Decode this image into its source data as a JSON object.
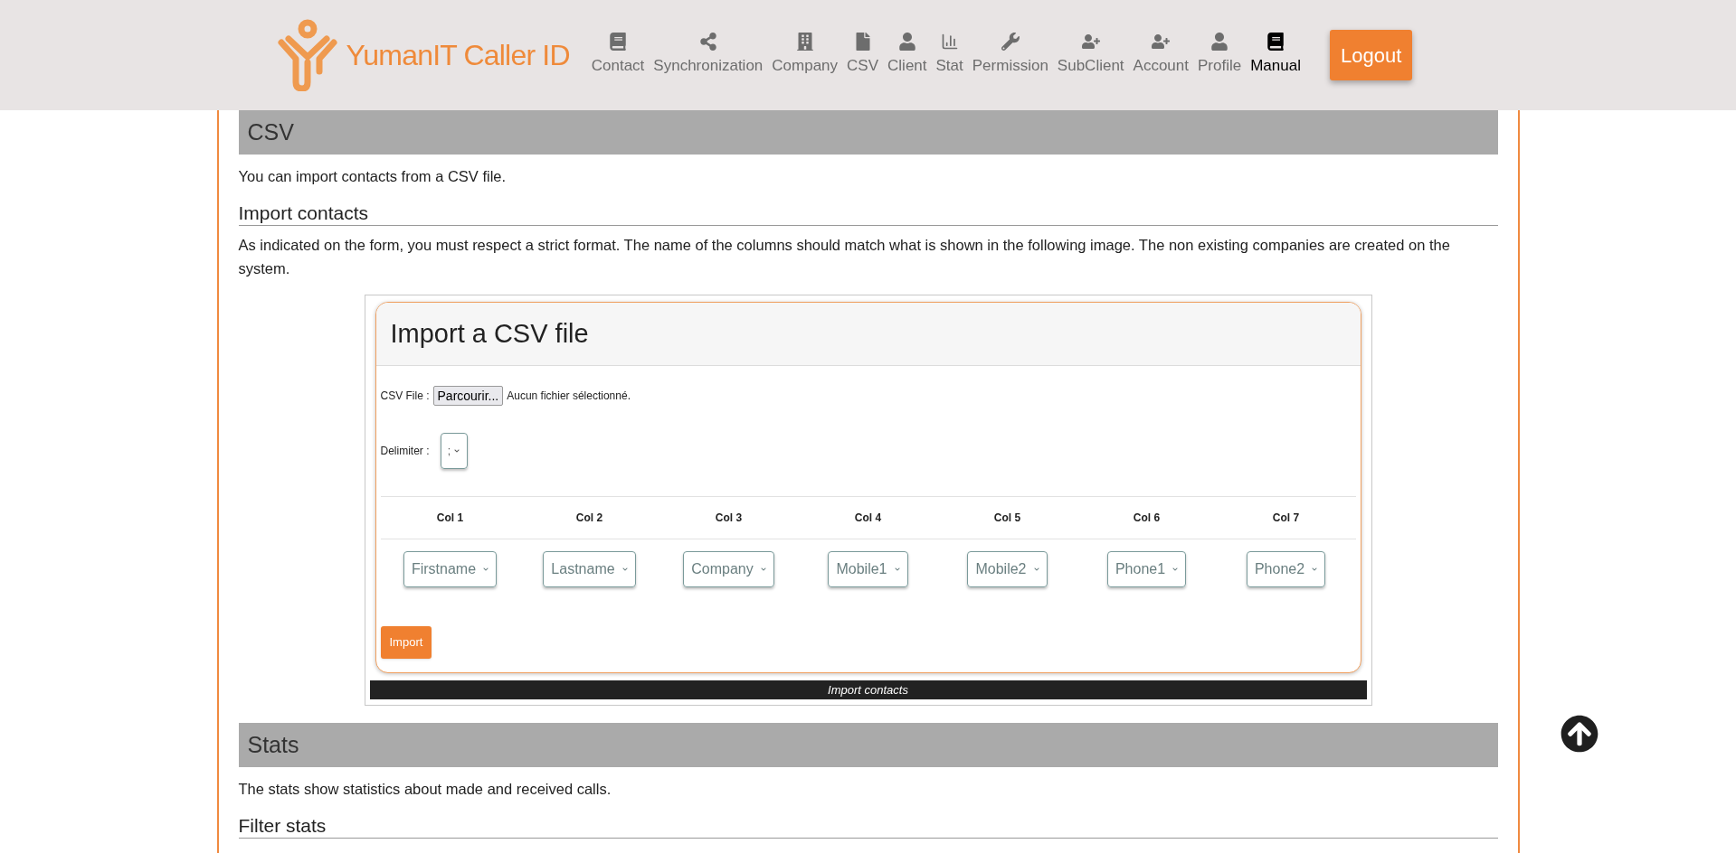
{
  "header": {
    "brand": "YumanIT Caller ID",
    "nav": [
      {
        "label": "Contact",
        "selected": false
      },
      {
        "label": "Synchronization",
        "selected": false
      },
      {
        "label": "Company",
        "selected": false
      },
      {
        "label": "CSV",
        "selected": false
      },
      {
        "label": "Client",
        "selected": false
      },
      {
        "label": "Stat",
        "selected": false
      },
      {
        "label": "Permission",
        "selected": false
      },
      {
        "label": "SubClient",
        "selected": false
      },
      {
        "label": "Account",
        "selected": false
      },
      {
        "label": "Profile",
        "selected": false
      },
      {
        "label": "Manual",
        "selected": true
      }
    ],
    "logout": "Logout"
  },
  "sections": [
    {
      "title": "CSV",
      "intro": "You can import contacts from a CSV file.",
      "subsections": [
        {
          "title": "Import contacts",
          "text": "As indicated on the form, you must respect a strict format. The name of the columns should match what is shown in the following image. The non existing companies are created on the system.",
          "figure": {
            "form_title": "Import a CSV file",
            "file_label": "CSV File :",
            "browse_button": "Parcourir...",
            "file_status": "Aucun fichier sélectionné.",
            "delimiter_label": "Delimiter :",
            "delimiter_value": ";",
            "columns": [
              {
                "header": "Col 1",
                "value": "Firstname"
              },
              {
                "header": "Col 2",
                "value": "Lastname"
              },
              {
                "header": "Col 3",
                "value": "Company"
              },
              {
                "header": "Col 4",
                "value": "Mobile1"
              },
              {
                "header": "Col 5",
                "value": "Mobile2"
              },
              {
                "header": "Col 6",
                "value": "Phone1"
              },
              {
                "header": "Col 7",
                "value": "Phone2"
              }
            ],
            "submit": "Import",
            "caption": "Import contacts"
          }
        }
      ]
    },
    {
      "title": "Stats",
      "intro": "The stats show statistics about made and received calls.",
      "subsections": [
        {
          "title": "Filter stats"
        }
      ]
    }
  ]
}
